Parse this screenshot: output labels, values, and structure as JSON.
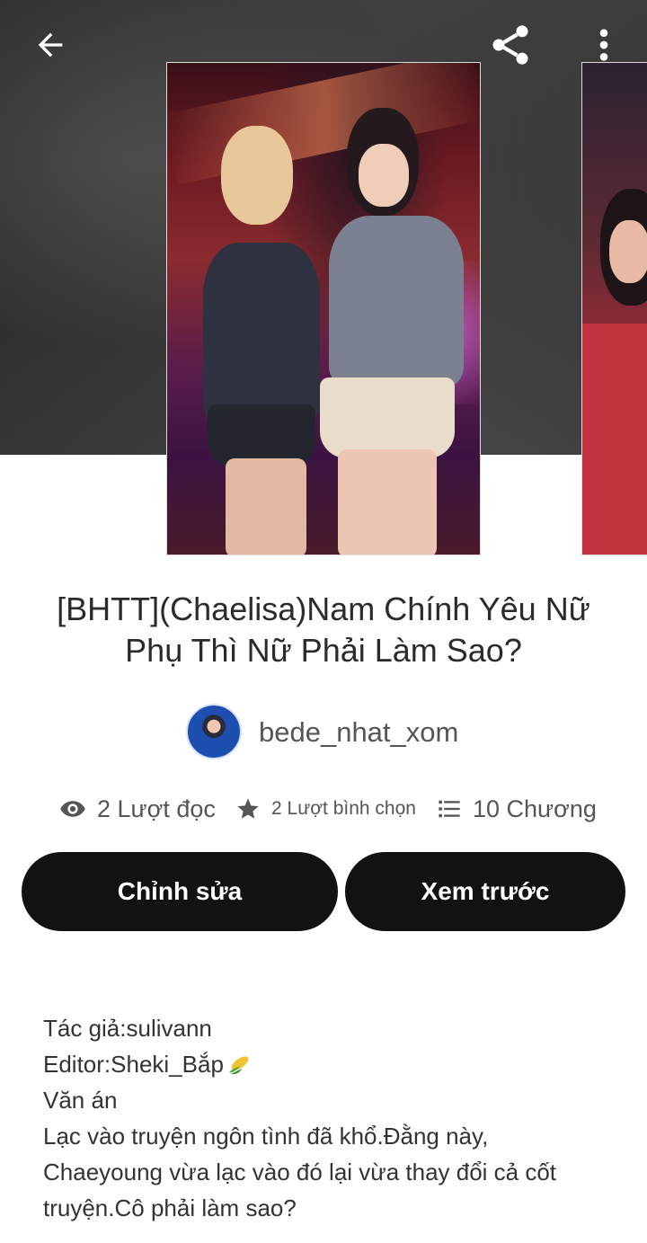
{
  "story": {
    "title_line1": "[BHTT](Chaelisa)Nam Chính Yêu Nữ",
    "title_line2": "Phụ Thì Nữ Phải Làm Sao?",
    "author": "bede_nhat_xom"
  },
  "stats": {
    "reads": "2 Lượt đọc",
    "votes": "2 Lượt bình chọn",
    "parts": "10 Chương"
  },
  "actions": {
    "edit_label": "Chỉnh sửa",
    "preview_label": "Xem trước"
  },
  "description": {
    "line1": "Tác giả:sulivann",
    "line2": "Editor:Sheki_Bắp",
    "line3": "Văn án",
    "line4": "Lạc vào truyện ngôn tình đã khổ.Đằng này,",
    "line5": "Chaeyoung vừa lạc vào đó lại vừa thay đổi cả cốt",
    "line6": "truyện.Cô phải làm sao?"
  },
  "icons": {
    "back": "arrow-left-icon",
    "share": "share-icon",
    "more": "more-vertical-icon",
    "reads": "eye-icon",
    "votes": "star-icon",
    "parts": "list-icon",
    "corn": "corn-emoji"
  },
  "colors": {
    "button_bg": "#121212",
    "button_text": "#ffffff",
    "text_primary": "#2b2b2b",
    "text_secondary": "#555555"
  }
}
